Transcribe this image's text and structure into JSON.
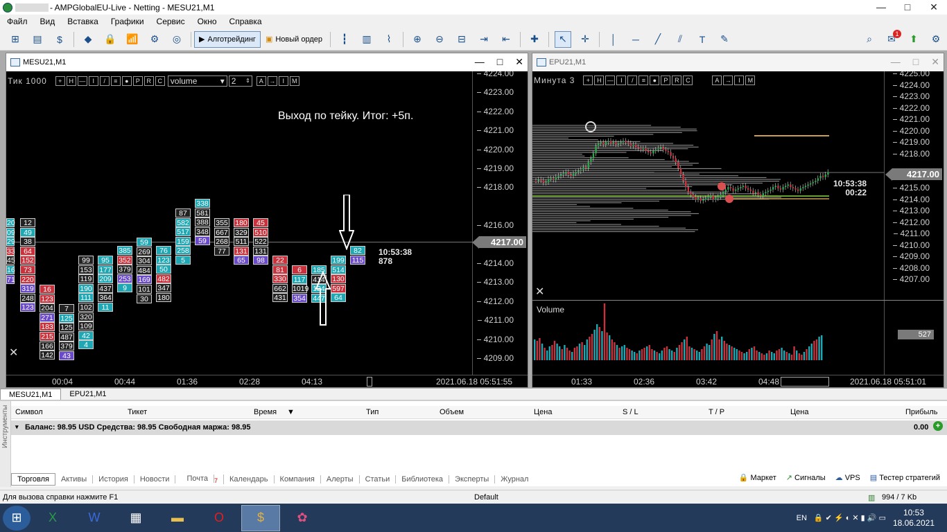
{
  "window": {
    "title": "- AMPGlobalEU-Live - Netting - MESU21,M1",
    "controls": {
      "minimize": "—",
      "maximize": "□",
      "close": "✕"
    }
  },
  "menu": [
    "Файл",
    "Вид",
    "Вставка",
    "Графики",
    "Сервис",
    "Окно",
    "Справка"
  ],
  "toolbar": {
    "algo_label": "Алготрейдинг",
    "new_order_label": "Новый ордер",
    "notif_count": "1"
  },
  "left_chart": {
    "title": "MESU21,M1",
    "mode_label": "Тик 1000",
    "tool_buttons": [
      "+",
      "H",
      "—",
      "I",
      "/",
      "≡",
      "●",
      "P",
      "R",
      "C"
    ],
    "tool_buttons_right": [
      "A",
      "→",
      "I",
      "M"
    ],
    "indicator_select": "volume",
    "indicator_num": "2",
    "annotation": "Выход по тейку. Итог: +5п.",
    "price_ticks": [
      "4224.00",
      "4223.00",
      "4222.00",
      "4221.00",
      "4220.00",
      "4219.00",
      "4218.00",
      "4217.00",
      "4216.00",
      "4215.00",
      "4214.00",
      "4213.00",
      "4212.00",
      "4211.00",
      "4210.00",
      "4209.00"
    ],
    "current_price": "4217.00",
    "countdown_time": "10:53:38",
    "countdown_value": "878",
    "time_ticks": [
      "00:04",
      "00:44",
      "01:36",
      "02:28",
      "04:13"
    ],
    "time_current": "2021.06.18 05:51:55"
  },
  "right_chart": {
    "title": "EPU21,M1",
    "mode_label": "Минута 3",
    "tool_buttons": [
      "+",
      "H",
      "—",
      "I",
      "/",
      "≡",
      "●",
      "P",
      "R",
      "C"
    ],
    "tool_buttons_right": [
      "A",
      "→",
      "I",
      "M"
    ],
    "price_ticks": [
      "4225.00",
      "4224.00",
      "4223.00",
      "4222.00",
      "4221.00",
      "4220.00",
      "4219.00",
      "4218.00",
      "4217.00",
      "4216.00",
      "4215.00",
      "4214.00",
      "4213.00",
      "4212.00",
      "4211.00",
      "4210.00",
      "4209.00",
      "4208.00",
      "4207.00"
    ],
    "current_price": "4217.00",
    "countdown_time": "10:53:38",
    "countdown_value": "00:22",
    "volume_label": "Volume",
    "volume_value": "527",
    "time_ticks": [
      "01:33",
      "02:36",
      "03:42",
      "04:48"
    ],
    "time_current": "2021.06.18 05:51:01"
  },
  "chart_tabs": [
    "MESU21,M1",
    "EPU21,M1"
  ],
  "terminal": {
    "side_label": "Инструменты",
    "columns": [
      "Символ",
      "Тикет",
      "Время",
      "Тип",
      "Объем",
      "Цена",
      "S / L",
      "T / P",
      "Цена",
      "Прибыль"
    ],
    "balance_text": "Баланс: 98.95 USD  Средства: 98.95  Свободная маржа: 98.95",
    "profit": "0.00",
    "tabs": [
      "Торговля",
      "Активы",
      "История",
      "Новости",
      "Почта",
      "Календарь",
      "Компания",
      "Алерты",
      "Статьи",
      "Библиотека",
      "Эксперты",
      "Журнал"
    ],
    "mail_badge": "7",
    "right_links": [
      "Маркет",
      "Сигналы",
      "VPS",
      "Тестер стратегий"
    ]
  },
  "status": {
    "help": "Для вызова справки нажмите F1",
    "profile": "Default",
    "traffic": "994 / 7 Kb"
  },
  "taskbar": {
    "lang": "EN",
    "time": "10:53",
    "date": "18.06.2021"
  },
  "colors": {
    "bull": "#1fa8b4",
    "bear": "#c8323c",
    "neutral": "#222",
    "vol_blue": "#1fa8b4",
    "vol_red": "#c8323c"
  }
}
